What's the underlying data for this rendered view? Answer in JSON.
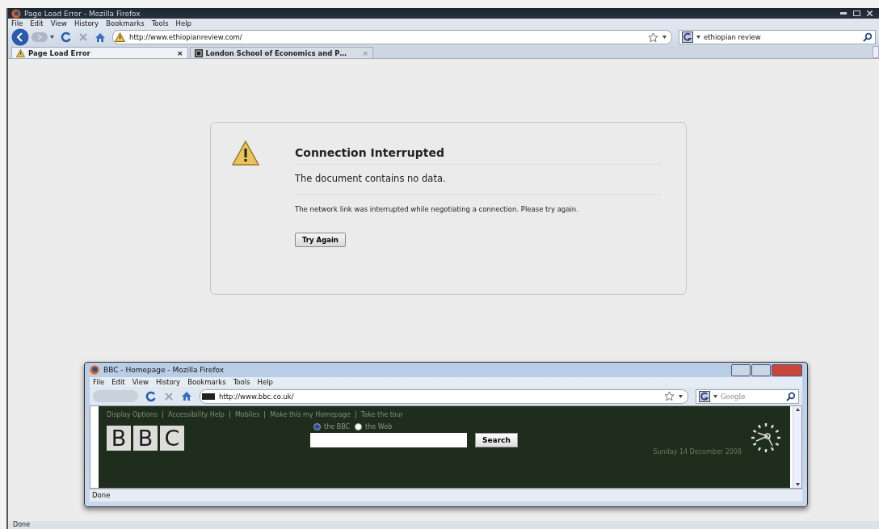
{
  "window": {
    "title": "Page Load Error - Mozilla Firefox"
  },
  "menu": [
    "File",
    "Edit",
    "View",
    "History",
    "Bookmarks",
    "Tools",
    "Help"
  ],
  "address": {
    "value": "http://www.ethiopianreview.com/"
  },
  "search": {
    "value": "ethiopian review"
  },
  "tabs": [
    {
      "label": "Page Load Error",
      "selected": true,
      "close": "×"
    },
    {
      "label": "London School of Economics and P…",
      "selected": false,
      "close": "×"
    }
  ],
  "error": {
    "title": "Connection Interrupted",
    "summary": "The document contains no data.",
    "detail": "The network link was interrupted while negotiating a connection. Please try again.",
    "button": "Try Again"
  },
  "popup": {
    "title": "BBC - Homepage - Mozilla Firefox",
    "menu": [
      "File",
      "Edit",
      "View",
      "History",
      "Bookmarks",
      "Tools",
      "Help"
    ],
    "address": "http://www.bbc.co.uk/",
    "search_placeholder": "Google",
    "page": {
      "links": [
        "Display Options",
        "Accessibility Help",
        "Mobiles",
        "Make this my Homepage",
        "Take the tour"
      ],
      "logo": [
        "B",
        "B",
        "C"
      ],
      "scopes": [
        {
          "label": "the BBC",
          "selected": true
        },
        {
          "label": "the Web",
          "selected": false
        }
      ],
      "search_button": "Search",
      "date": "Sunday 14 December 2008"
    },
    "status": "Done"
  },
  "status_bar": "Done"
}
